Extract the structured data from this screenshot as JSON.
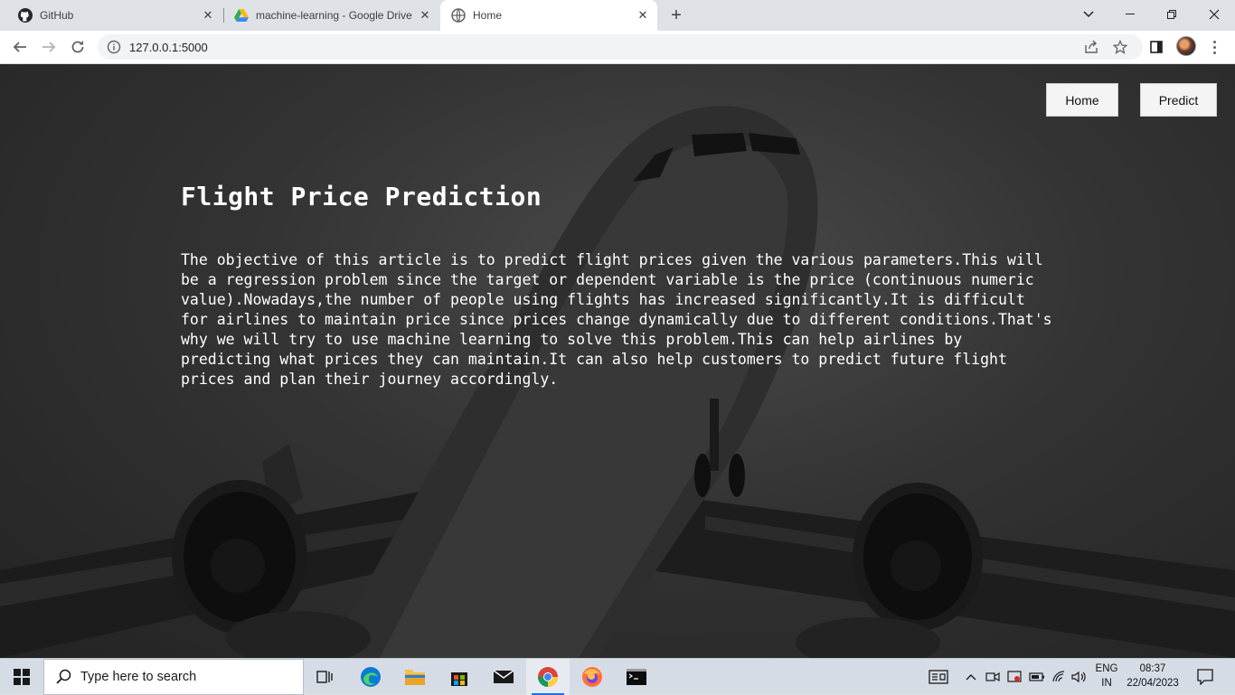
{
  "browser": {
    "tabs": [
      {
        "title": "GitHub",
        "icon": "github-icon"
      },
      {
        "title": "machine-learning - Google Drive",
        "icon": "google-drive-icon"
      },
      {
        "title": "Home",
        "icon": "globe-icon",
        "active": true
      }
    ],
    "url": "127.0.0.1:5000"
  },
  "page": {
    "nav": {
      "home_label": "Home",
      "predict_label": "Predict"
    },
    "title": "Flight Price Prediction",
    "description": "The objective of this article is to predict flight prices given the various parameters.This will be a regression problem since the target or dependent variable is the price (continuous numeric value).Nowadays,the number of people using flights has increased significantly.It is difficult for airlines to maintain price since prices change dynamically due to different conditions.That's why we will try to use machine learning to solve this problem.This can help airlines by predicting what prices they can maintain.It can also help customers to predict future flight prices and plan their journey accordingly."
  },
  "taskbar": {
    "search_placeholder": "Type here to search",
    "language": "ENG",
    "region": "IN",
    "time": "08:37",
    "date": "22/04/2023"
  }
}
